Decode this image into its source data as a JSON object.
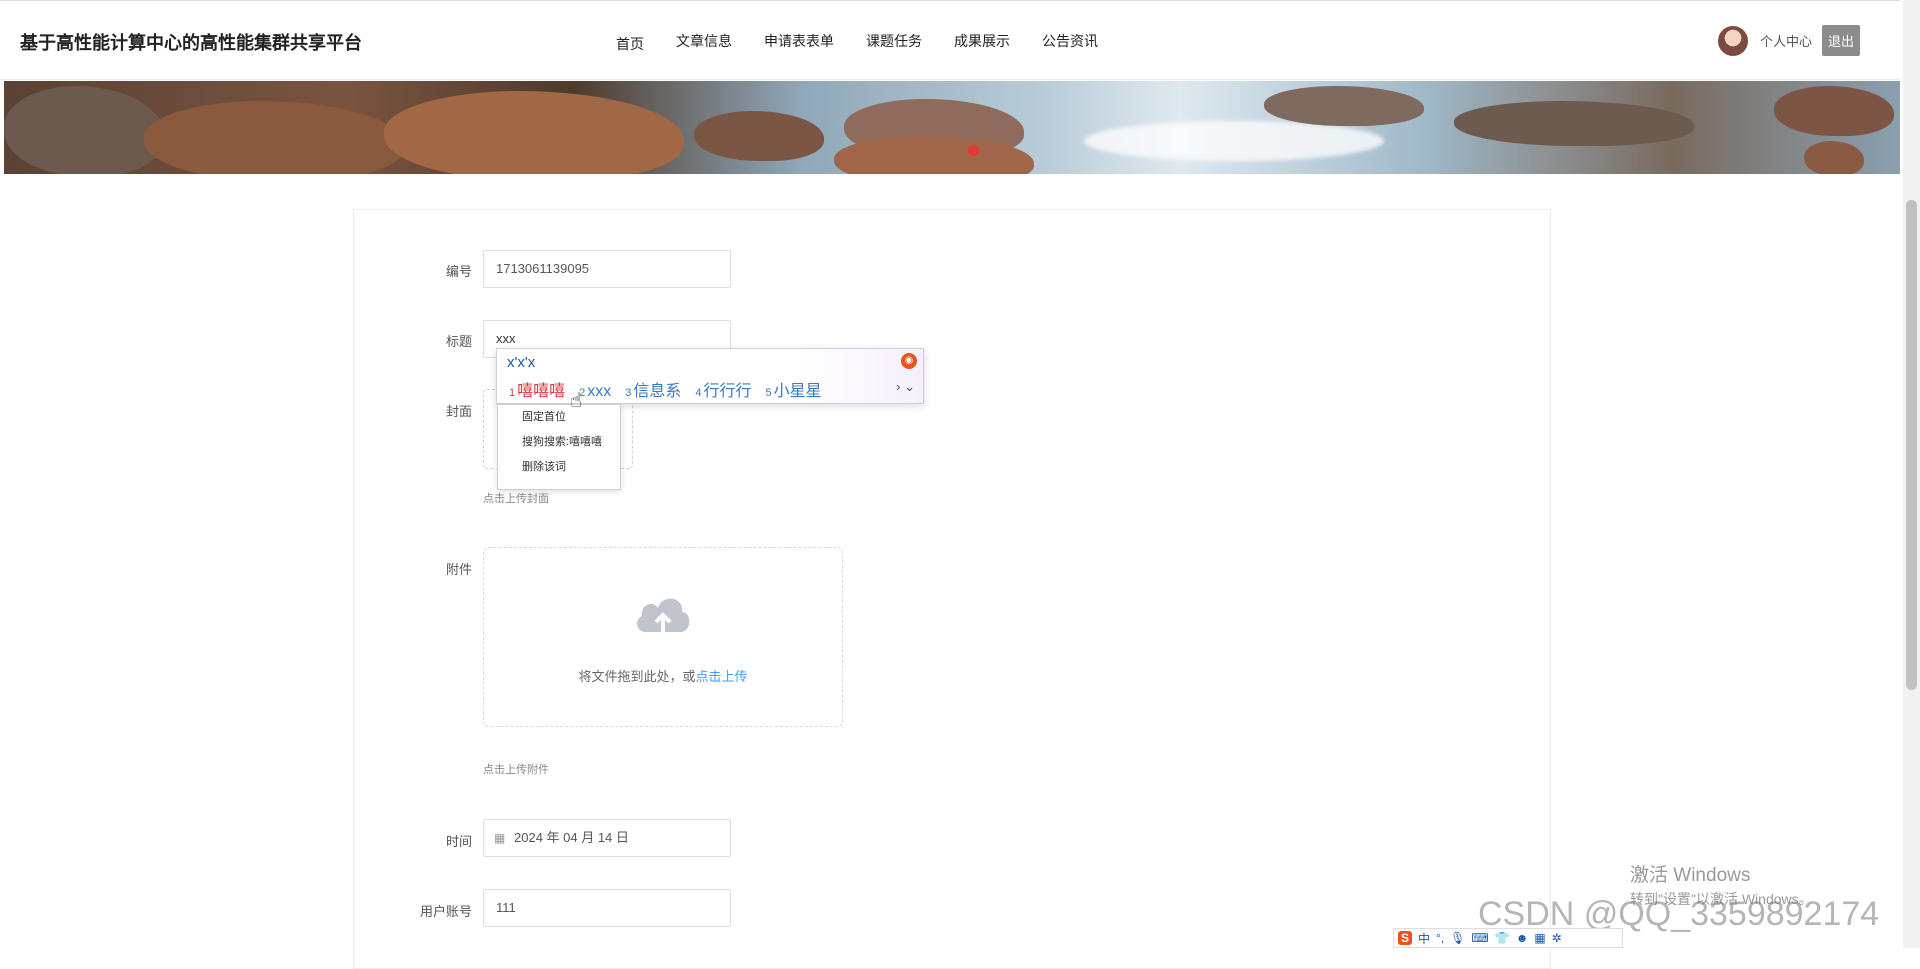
{
  "header": {
    "site_title": "基于高性能计算中心的高性能集群共享平台",
    "nav": [
      "首页",
      "文章信息",
      "申请表表单",
      "课题任务",
      "成果展示",
      "公告资讯"
    ],
    "user_center": "个人中心",
    "logout": "退出"
  },
  "form": {
    "id_label": "编号",
    "id_value": "1713061139095",
    "title_label": "标题",
    "title_value": "xxx",
    "cover_label": "封面",
    "cover_hint": "点击上传封面",
    "attachment_label": "附件",
    "drop_text": "将文件拖到此处，或",
    "drop_link": "点击上传",
    "attachment_hint": "点击上传附件",
    "time_label": "时间",
    "time_value": "2024 年 04 月 14 日",
    "account_label": "用户账号",
    "account_value": "111"
  },
  "ime": {
    "input": "x'x'x",
    "candidates": [
      {
        "num": "1",
        "text": "嘻嘻嘻"
      },
      {
        "num": "2",
        "text": "xxx"
      },
      {
        "num": "3",
        "text": "信息系"
      },
      {
        "num": "4",
        "text": "行行行"
      },
      {
        "num": "5",
        "text": "小星星"
      }
    ],
    "more": "› ⌄",
    "context_menu": [
      "固定首位",
      "搜狗搜索:嘻嘻嘻",
      "删除该词"
    ]
  },
  "overlay": {
    "windows_activate_line1": "激活 Windows",
    "windows_activate_line2": "转到\"设置\"以激活 Windows。",
    "watermark": "CSDN @QQ_3359892174",
    "ime_toolbar_logo": "S",
    "ime_toolbar_mode": "中"
  },
  "colors": {
    "accent": "#409eff",
    "logout_bg": "#8c8c8c",
    "ime_active": "#d7383a",
    "ime_candidate": "#3b78c2",
    "banner_indicator": "#e53935"
  }
}
